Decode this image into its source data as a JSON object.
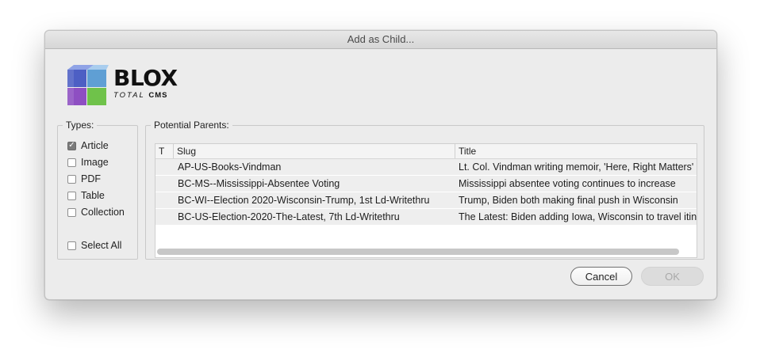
{
  "window": {
    "title": "Add as Child..."
  },
  "logo": {
    "name": "BLOX",
    "sub_total": "TOTAL",
    "sub_cms": "CMS"
  },
  "types": {
    "legend": "Types:",
    "items": [
      {
        "label": "Article",
        "checked": true
      },
      {
        "label": "Image",
        "checked": false
      },
      {
        "label": "PDF",
        "checked": false
      },
      {
        "label": "Table",
        "checked": false
      },
      {
        "label": "Collection",
        "checked": false
      }
    ],
    "select_all": {
      "label": "Select All",
      "checked": false
    }
  },
  "parents": {
    "legend": "Potential Parents:",
    "columns": [
      "T",
      "Slug",
      "Title"
    ],
    "rows": [
      {
        "t": "",
        "slug": "AP-US-Books-Vindman",
        "title": "Lt. Col. Vindman writing memoir, 'Here, Right Matters'"
      },
      {
        "t": "",
        "slug": "BC-MS--Mississippi-Absentee Voting",
        "title": "Mississippi absentee voting continues to increase"
      },
      {
        "t": "",
        "slug": "BC-WI--Election 2020-Wisconsin-Trump, 1st Ld-Writethru",
        "title": "Trump, Biden both making final push in Wisconsin"
      },
      {
        "t": "",
        "slug": "BC-US-Election-2020-The-Latest, 7th Ld-Writethru",
        "title": "The Latest: Biden adding Iowa, Wisconsin to travel itinerary"
      }
    ]
  },
  "buttons": {
    "cancel": "Cancel",
    "ok": "OK"
  }
}
